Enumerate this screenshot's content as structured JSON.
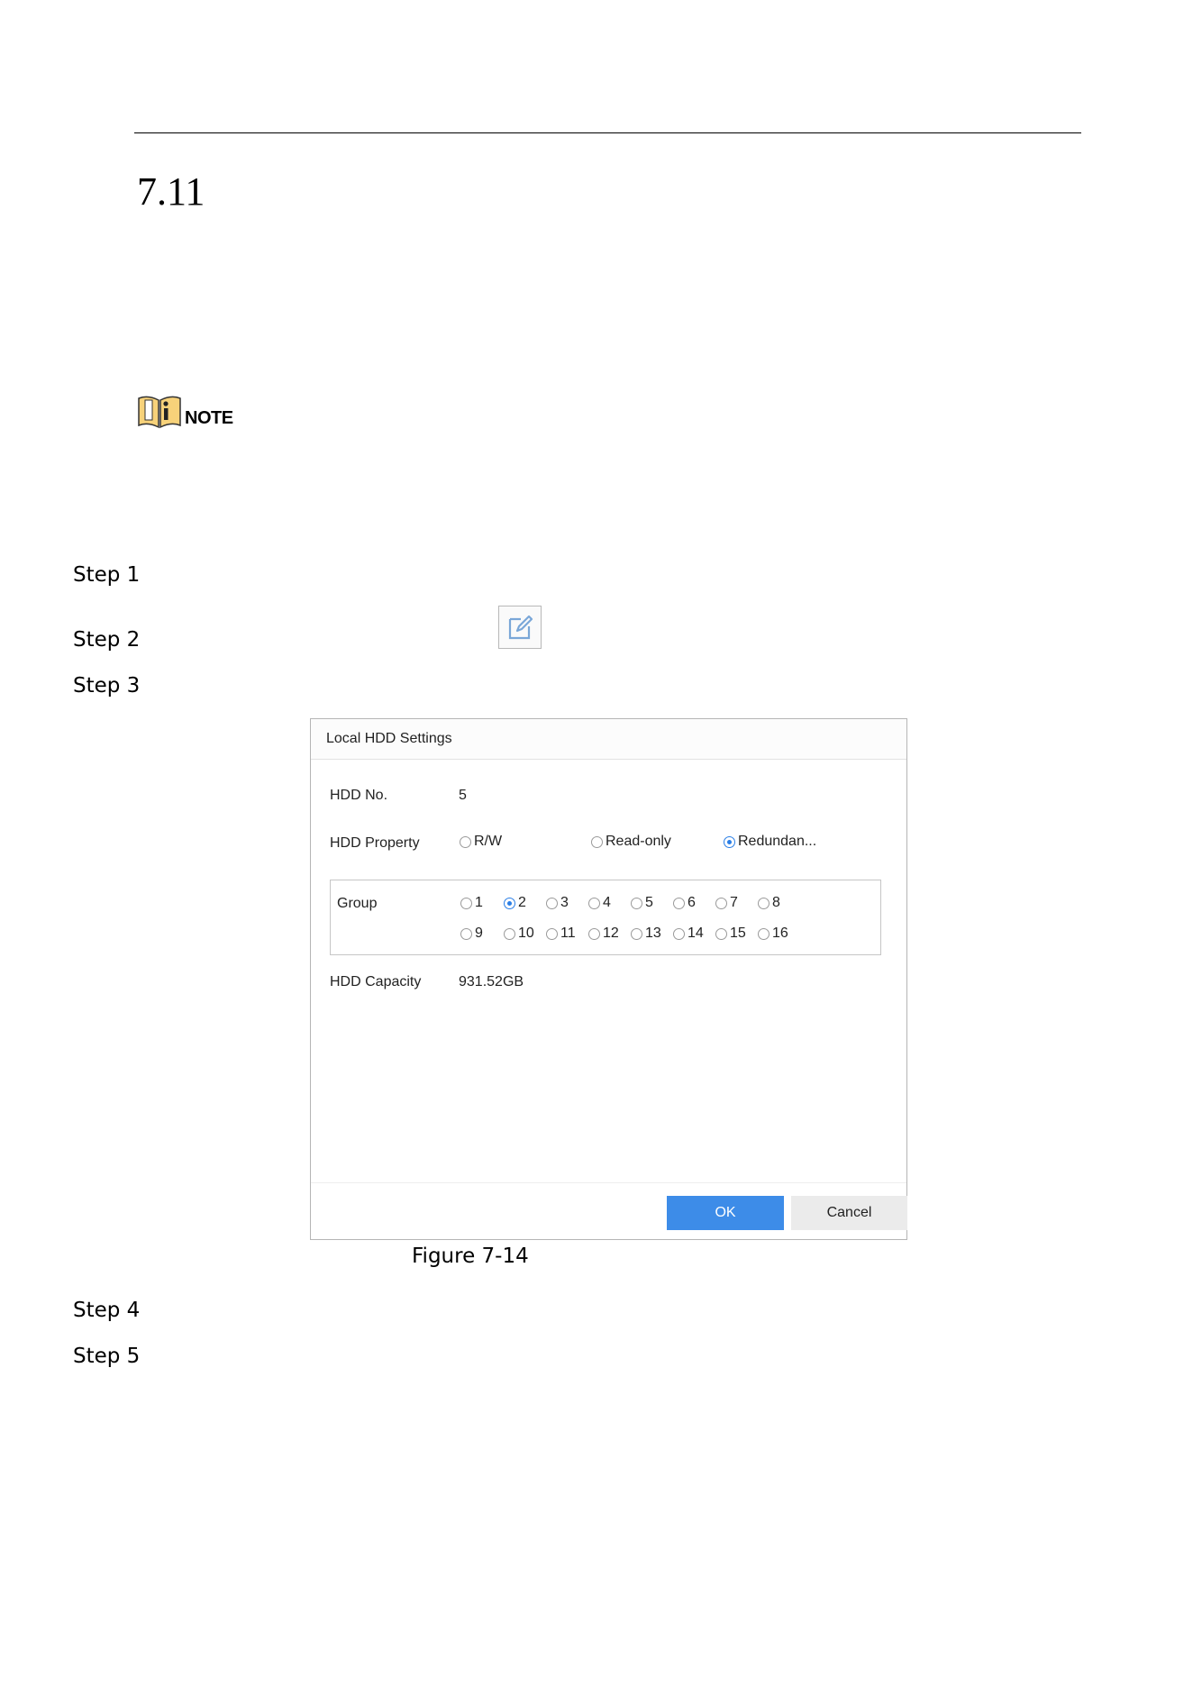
{
  "section": {
    "number": "7.11"
  },
  "note": {
    "label": "NOTE"
  },
  "steps": [
    "Step 1",
    "Step 2",
    "Step 3",
    "Step 4",
    "Step 5"
  ],
  "dialog": {
    "title": "Local HDD Settings",
    "hdd_no": {
      "label": "HDD No.",
      "value": "5"
    },
    "hdd_property": {
      "label": "HDD Property",
      "options": [
        "R/W",
        "Read-only",
        "Redundan..."
      ],
      "selected": "Redundan..."
    },
    "group": {
      "label": "Group",
      "options": [
        "1",
        "2",
        "3",
        "4",
        "5",
        "6",
        "7",
        "8",
        "9",
        "10",
        "11",
        "12",
        "13",
        "14",
        "15",
        "16"
      ],
      "selected": "2"
    },
    "hdd_capacity": {
      "label": "HDD Capacity",
      "value": "931.52GB"
    },
    "buttons": {
      "ok": "OK",
      "cancel": "Cancel"
    },
    "accent_color": "#3d8ce8"
  },
  "figure": {
    "caption": "Figure 7-14"
  },
  "icons": {
    "note": "note-book-icon",
    "edit": "edit-icon"
  }
}
